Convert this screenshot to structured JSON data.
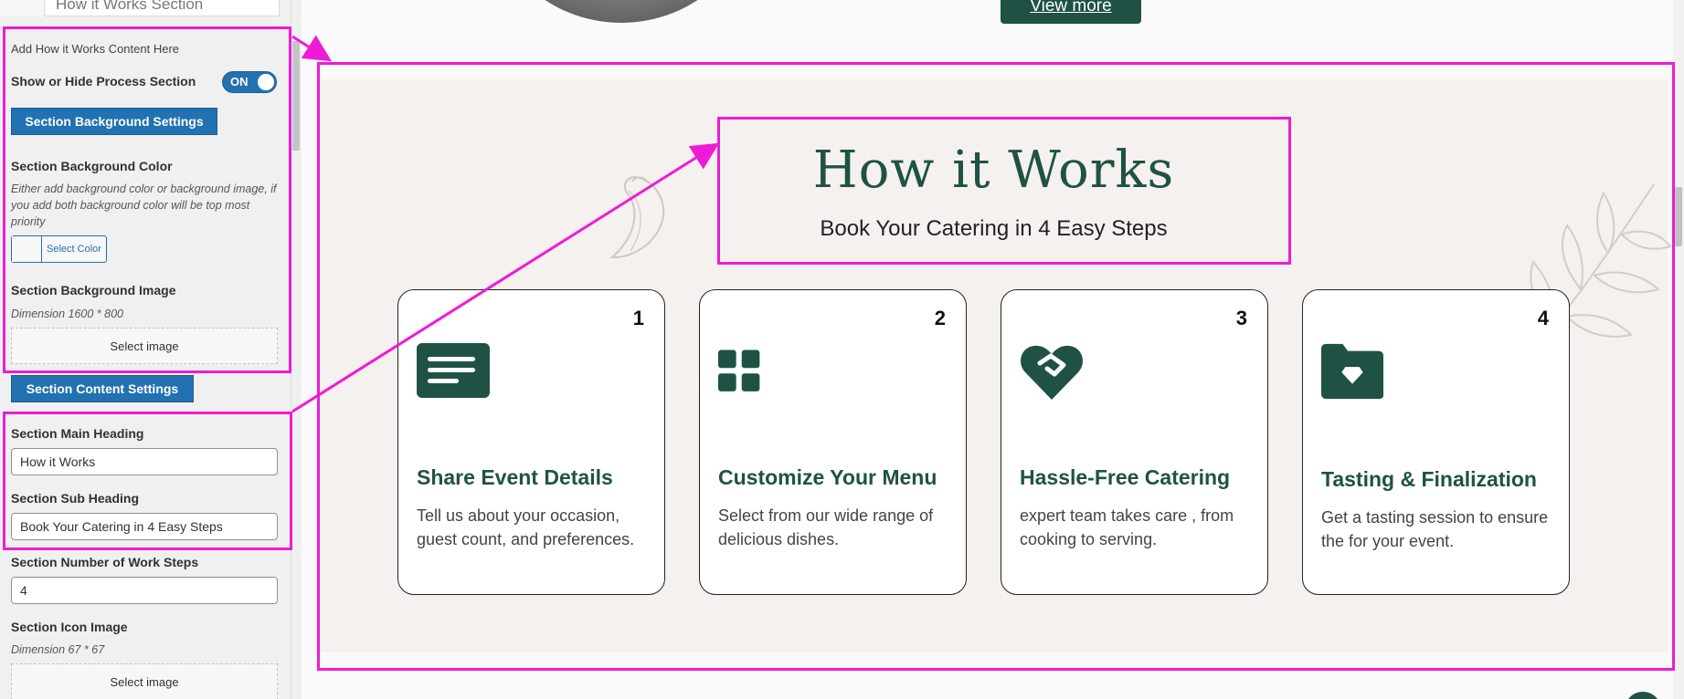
{
  "sidebar": {
    "top_tab": "How it Works Section",
    "intro": "Add How it Works Content Here",
    "toggle_label": "Show or Hide Process Section",
    "toggle_state": "ON",
    "bg_settings_button": "Section Background Settings",
    "bg_color_label": "Section Background Color",
    "bg_color_desc": "Either add background color or background image, if you add both background color will be top most priority",
    "select_color_button": "Select Color",
    "bg_image_label": "Section Background Image",
    "bg_image_dimension": "Dimension 1600 * 800",
    "select_image_button": "Select image",
    "content_settings_button": "Section Content Settings",
    "main_heading_label": "Section Main Heading",
    "main_heading_value": "How it Works",
    "sub_heading_label": "Section Sub Heading",
    "sub_heading_value": "Book Your Catering in 4 Easy Steps",
    "steps_label": "Section Number of Work Steps",
    "steps_value": "4",
    "icon_image_label": "Section Icon Image",
    "icon_image_dimension": "Dimension 67 * 67",
    "select_icon_button": "Select image"
  },
  "preview": {
    "view_more": "View more",
    "title": "How it Works",
    "subtitle": "Book Your Catering in 4 Easy Steps",
    "steps": [
      {
        "num": "1",
        "icon": "document-lines-icon",
        "title": "Share Event Details",
        "desc": "Tell us about your occasion, guest count, and preferences."
      },
      {
        "num": "2",
        "icon": "grid-icon",
        "title": "Customize Your Menu",
        "desc": "Select from our wide range of delicious dishes."
      },
      {
        "num": "3",
        "icon": "heart-handshake-icon",
        "title": "Hassle-Free Catering",
        "desc": "expert team takes care , from cooking to serving."
      },
      {
        "num": "4",
        "icon": "folder-diamond-icon",
        "title": "Tasting & Finalization",
        "desc": "Get a tasting session to ensure the for your event."
      }
    ]
  },
  "colors": {
    "accent_green": "#1f5245",
    "annotation_magenta": "#ee1bd6",
    "wp_blue": "#2271b1",
    "section_bg": "#f4f1ee"
  }
}
